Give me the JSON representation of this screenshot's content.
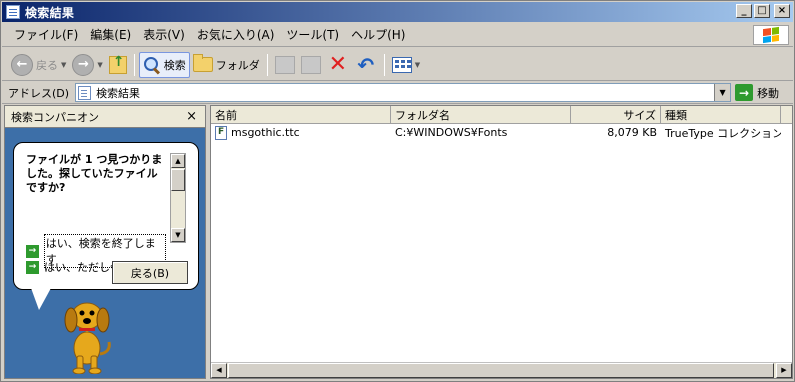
{
  "window": {
    "title": "検索結果",
    "minimize": "_",
    "maximize": "□",
    "close": "×"
  },
  "menu": {
    "items": [
      "ファイル(F)",
      "編集(E)",
      "表示(V)",
      "お気に入り(A)",
      "ツール(T)",
      "ヘルプ(H)"
    ]
  },
  "toolbar": {
    "back_label": "戻る",
    "search_label": "検索",
    "folders_label": "フォルダ"
  },
  "address": {
    "label": "アドレス(D)",
    "value": "検索結果",
    "go_label": "移動"
  },
  "companion": {
    "title": "検索コンパニオン",
    "close": "×",
    "message": "ファイルが 1 つ見つかりました。探していたファイルですか?",
    "option_yes_finish": "はい、検索を終了します",
    "option_yes_but": "はい、ただし今後の検索",
    "back_button": "戻る(B)"
  },
  "results": {
    "columns": {
      "name": "名前",
      "folder": "フォルダ名",
      "size": "サイズ",
      "type": "種類"
    },
    "rows": [
      {
        "name": "msgothic.ttc",
        "folder": "C:¥WINDOWS¥Fonts",
        "size": "8,079 KB",
        "type": "TrueType コレクション..."
      }
    ]
  },
  "colors": {
    "title_start": "#0a246a",
    "title_end": "#a6caf0",
    "companion_bg": "#3d6fa8",
    "go_green": "#2e9a2e",
    "delete_red": "#e02020"
  },
  "icons": [
    "document-icon",
    "windows-flag-icon",
    "back-icon",
    "forward-icon",
    "up-folder-icon",
    "search-icon",
    "folders-icon",
    "move-to-icon",
    "copy-to-icon",
    "delete-icon",
    "undo-icon",
    "views-icon",
    "go-arrow-icon",
    "dog-icon",
    "ttc-file-icon"
  ]
}
